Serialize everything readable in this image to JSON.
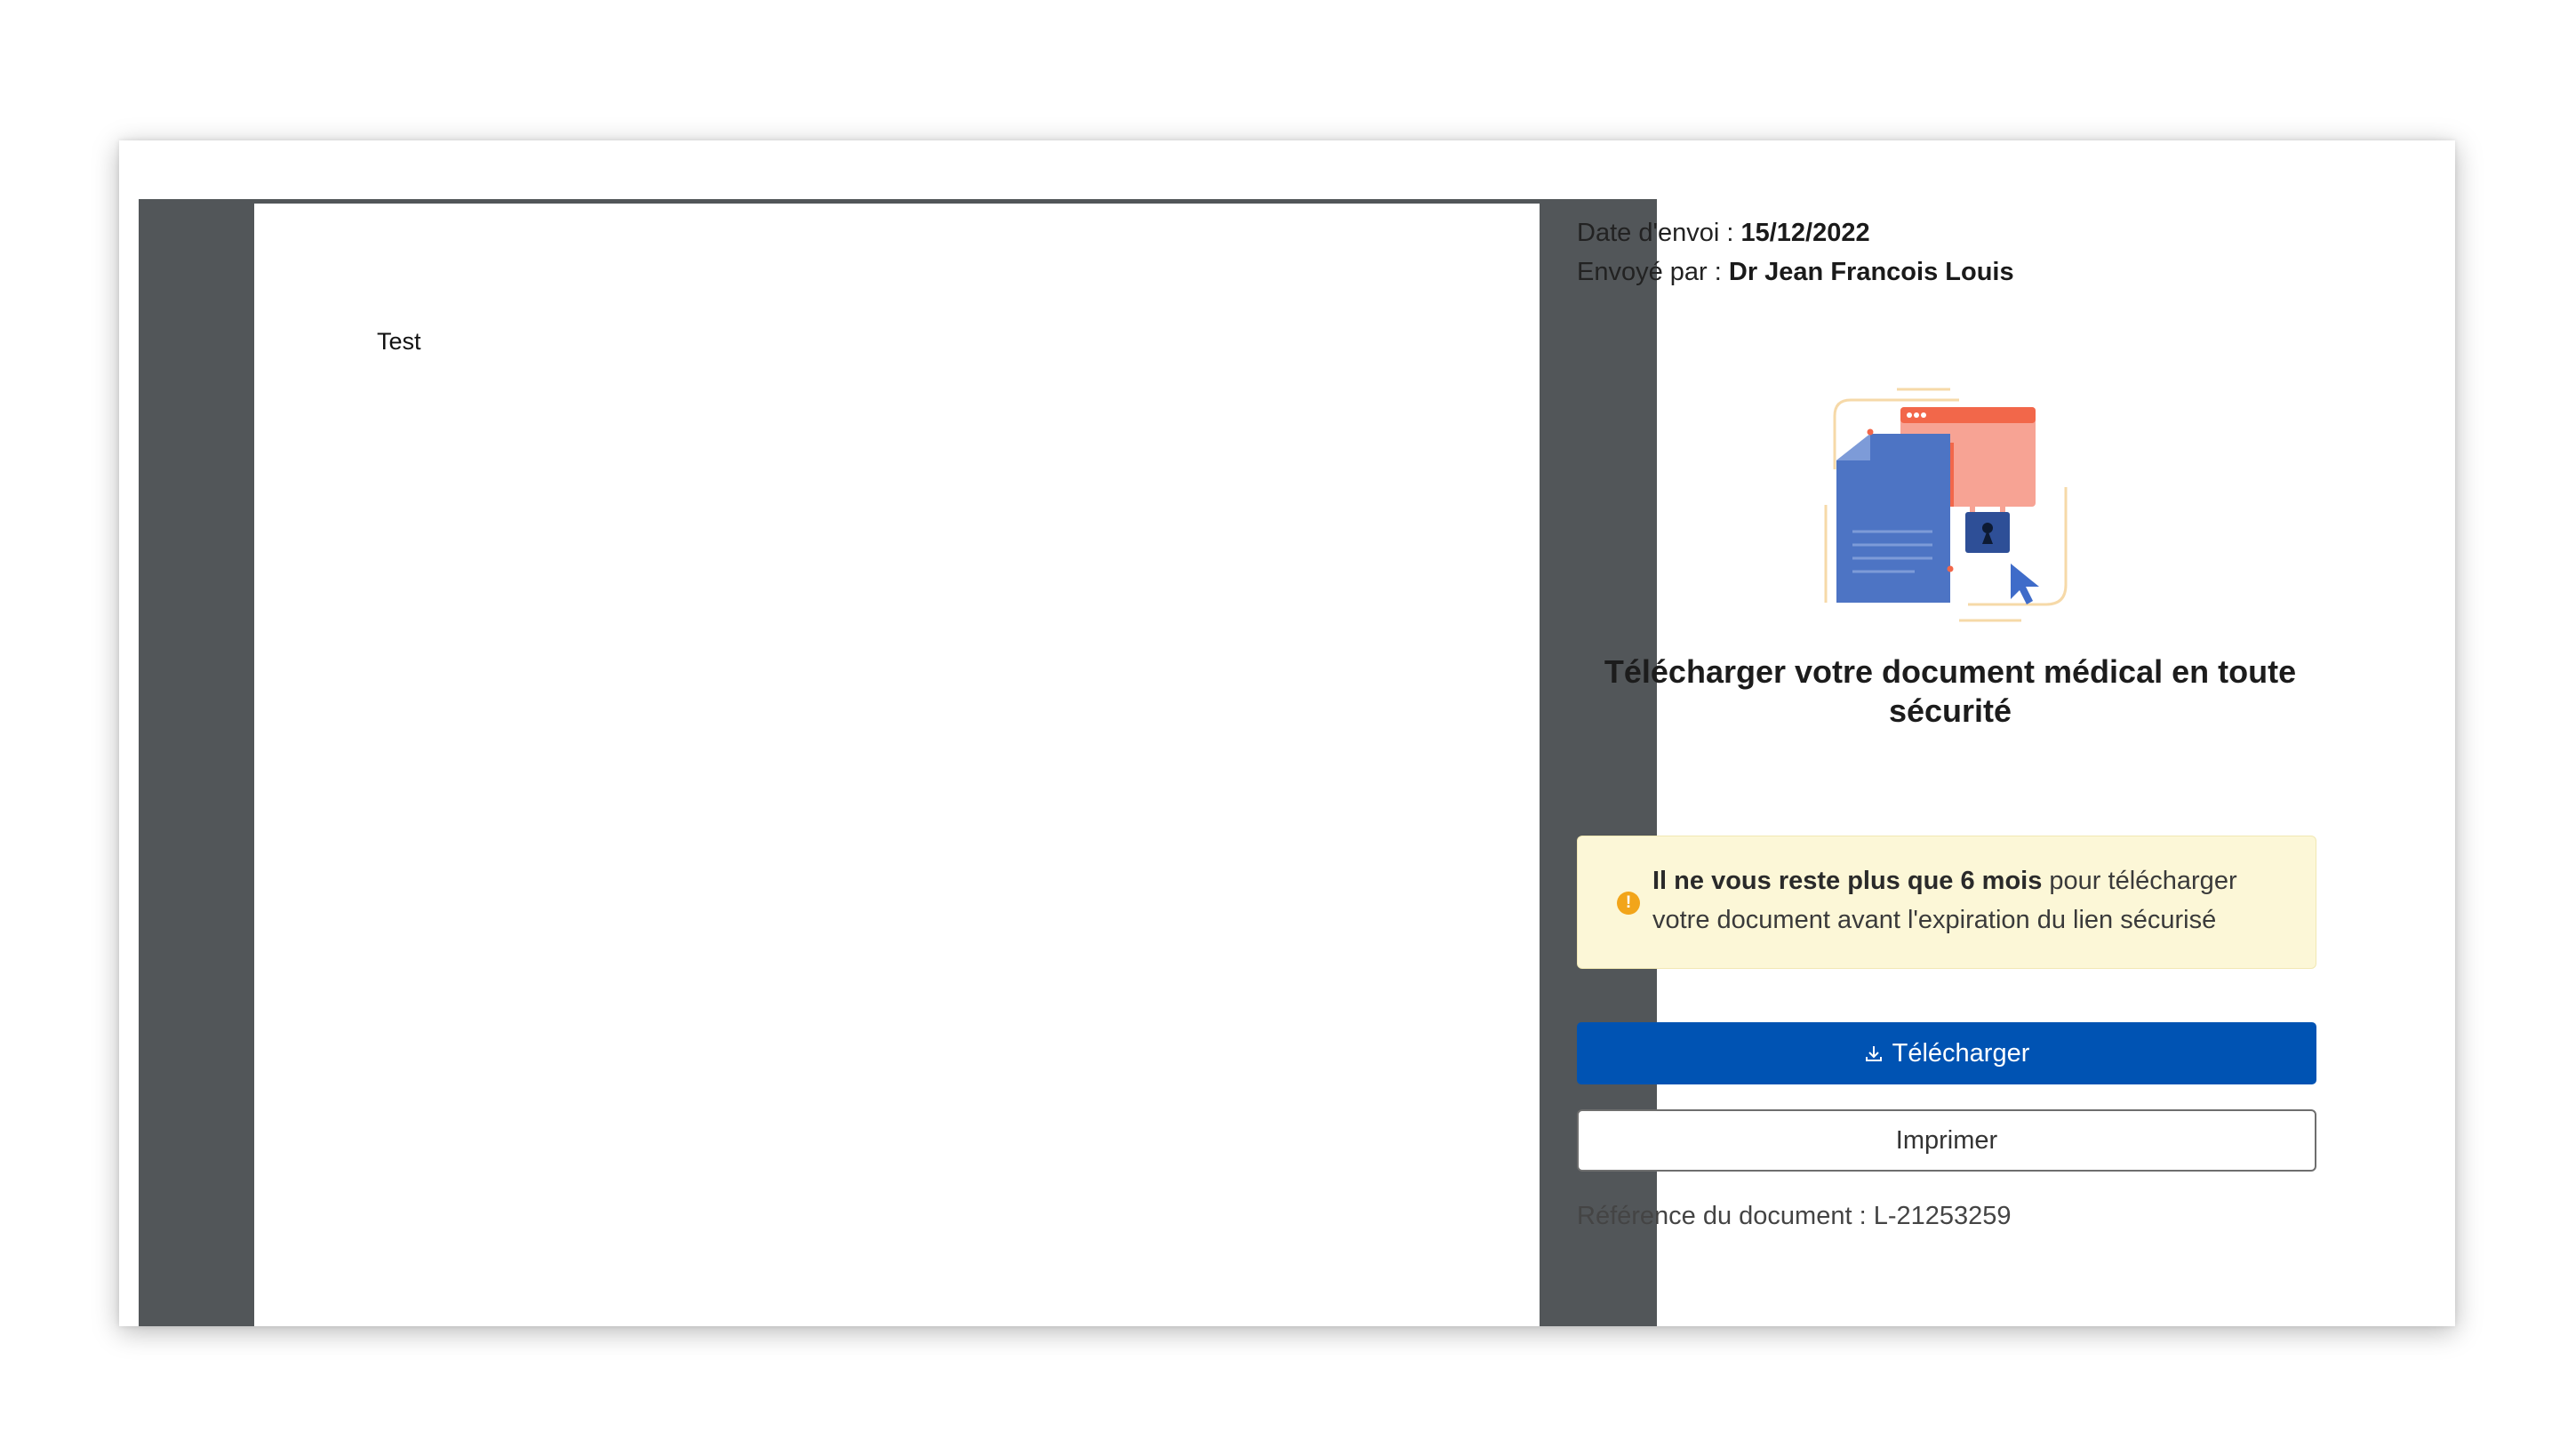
{
  "document_viewer": {
    "page_text": "Test"
  },
  "sidebar": {
    "date_label": "Date d'envoi :",
    "date_value": "15/12/2022",
    "sender_label": "Envoyé par :",
    "sender_value": "Dr Jean Francois Louis",
    "headline": "Télécharger votre document médical en toute sécurité",
    "notice": {
      "icon": "info-icon",
      "bold_text": "Il ne vous reste plus que 6 mois",
      "text": " pour télécharger votre document avant l'expiration du lien sécurisé",
      "icon_glyph": "!"
    },
    "download_button": {
      "icon": "download-icon",
      "label": "Télécharger"
    },
    "print_button": {
      "label": "Imprimer"
    },
    "reference": "Référence du document : L-21253259"
  },
  "colors": {
    "viewer_background": "#525659",
    "primary_button": "#0053b3",
    "notice_background": "#fcf7d7",
    "notice_icon": "#f2a51a"
  }
}
